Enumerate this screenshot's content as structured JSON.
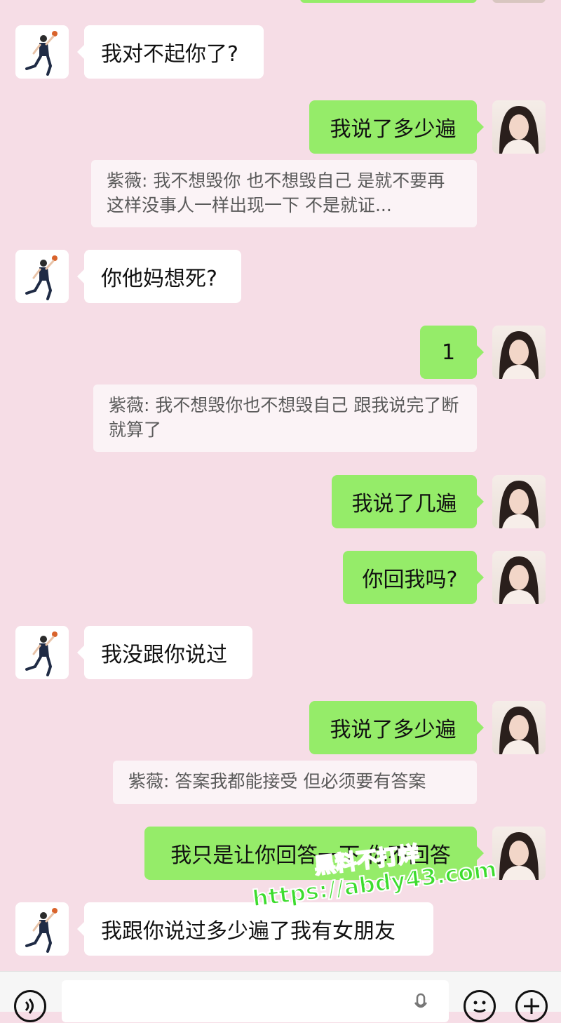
{
  "messages": [
    {
      "side": "left",
      "text": "我对不起你了?"
    },
    {
      "side": "right",
      "text": "我说了多少遍"
    },
    {
      "quote": "紫薇:  我不想毁你 也不想毁自己  是就不要再这样没事人一样出现一下  不是就证..."
    },
    {
      "side": "left",
      "text": "你他妈想死?"
    },
    {
      "side": "right",
      "text": "1"
    },
    {
      "quote": "紫薇:  我不想毁你也不想毁自己 跟我说完了断就算了"
    },
    {
      "side": "right",
      "text": "我说了几遍"
    },
    {
      "side": "right",
      "text": "你回我吗?"
    },
    {
      "side": "left",
      "text": "我没跟你说过"
    },
    {
      "side": "right",
      "text": "我说了多少遍"
    },
    {
      "quote": "紫薇:  答案我都能接受 但必须要有答案"
    },
    {
      "side": "right",
      "text": "我只是让你回答一下 你不回答"
    },
    {
      "side": "left",
      "text": "我跟你说过多少遍了我有女朋友"
    }
  ],
  "watermark": {
    "line1": "黑料不打烊",
    "line2": "https://abdy43.com"
  },
  "icons": {
    "voice": "voice-icon",
    "emoji": "emoji-icon",
    "plus": "plus-icon",
    "mic": "microphone-icon"
  },
  "colors": {
    "background": "#f6dde6",
    "sent_bubble": "#95ec69",
    "received_bubble": "#ffffff",
    "watermark": "#3ddc2e"
  }
}
